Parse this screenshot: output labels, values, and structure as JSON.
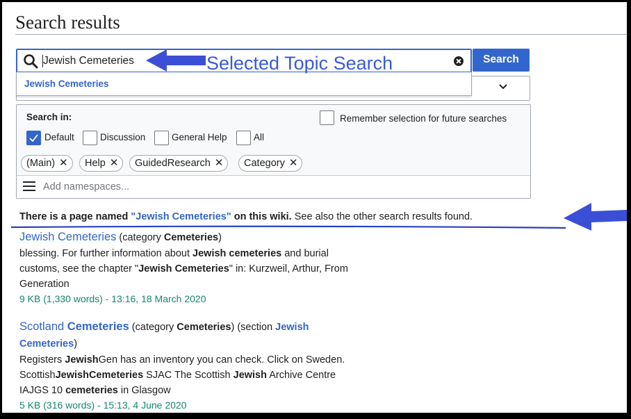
{
  "page": {
    "title": "Search results"
  },
  "search": {
    "query": "Jewish Cemeteries",
    "button_label": "Search",
    "suggestion": "Jewish Cemeteries"
  },
  "namespaces": {
    "search_in_label": "Search in:",
    "remember_label": "Remember selection for future searches",
    "options": [
      {
        "label": "Default",
        "checked": true
      },
      {
        "label": "Discussion",
        "checked": false
      },
      {
        "label": "General Help",
        "checked": false
      },
      {
        "label": "All",
        "checked": false
      }
    ],
    "chips": [
      "(Main)",
      "Help",
      "GuidedResearch",
      "Category"
    ],
    "chip_remove": "✕",
    "add_placeholder": "Add namespaces..."
  },
  "annotation": {
    "label": "Selected Topic Search",
    "color": "#3b5ad8"
  },
  "notice": {
    "prefix": "There is a page named ",
    "link": "\"Jewish Cemeteries\"",
    "middle": " on this wiki.",
    "suffix": " See also the other search results found."
  },
  "results": [
    {
      "title": "Jewish Cemeteries",
      "title_meta_prefix": " (category ",
      "title_meta_bold": "Cemeteries",
      "title_meta_suffix": ")",
      "lines": [
        [
          "blessing. For further information about ",
          "Jewish cemeteries",
          " and burial"
        ],
        [
          "customs, see the chapter \"",
          "Jewish Cemeteries",
          "\" in: Kurzweil, Arthur, From"
        ],
        [
          "Generation",
          "",
          ""
        ]
      ],
      "meta": "9 KB (1,330 words) - 13:16, 18 March 2020"
    },
    {
      "title_plain": "Scotland ",
      "title": "Cemeteries",
      "title_meta_prefix": " (category ",
      "title_meta_bold": "Cemeteries",
      "title_meta_mid": ") (section ",
      "section_1": "Jewish",
      "section_2": "Cemeteries",
      "title_meta_suffix": ")",
      "lines": [
        [
          "Registers ",
          "Jewish",
          "Gen has an inventory you can check. Click on Sweden."
        ],
        [
          "Scottish",
          "JewishCemeteries",
          " SJAC The Scottish "
        ],
        [
          "IAJGS 10 ",
          "cemeteries",
          " in Glasgow"
        ]
      ],
      "line2_bold2": "Jewish",
      "line2_tail": " Archive Centre",
      "meta": "5 KB (316 words) - 15:13, 4 June 2020"
    }
  ],
  "colors": {
    "accent": "#3366cc",
    "result_meta": "#14866d",
    "annotation": "#3b5ad8"
  }
}
